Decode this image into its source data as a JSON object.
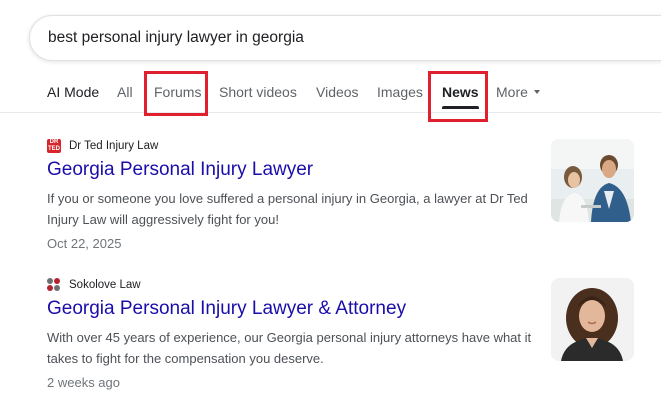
{
  "search": {
    "query": "best personal injury lawyer in georgia"
  },
  "tabs": [
    {
      "label": "AI Mode"
    },
    {
      "label": "All"
    },
    {
      "label": "Forums"
    },
    {
      "label": "Short videos"
    },
    {
      "label": "Videos"
    },
    {
      "label": "Images"
    },
    {
      "label": "News"
    },
    {
      "label": "More"
    }
  ],
  "active_tab": "News",
  "results": [
    {
      "source": "Dr Ted Injury Law",
      "favicon_text": "DR TED",
      "title": "Georgia Personal Injury Lawyer",
      "snippet_line1": "If you or someone you love suffered a personal injury in Georgia, a lawyer at Dr Ted",
      "snippet_line2": "Injury Law will aggressively fight for you!",
      "date": "Oct 22, 2025"
    },
    {
      "source": "Sokolove Law",
      "title": "Georgia Personal Injury Lawyer & Attorney",
      "snippet_line1": "With over 45 years of experience, our Georgia personal injury attorneys have what it",
      "snippet_line2": "takes to fight for the compensation you deserve.",
      "date": "2 weeks ago"
    }
  ],
  "colors": {
    "link": "#1a0dab",
    "highlight_box": "#e0202e",
    "favicon_red": "#d7262b"
  }
}
